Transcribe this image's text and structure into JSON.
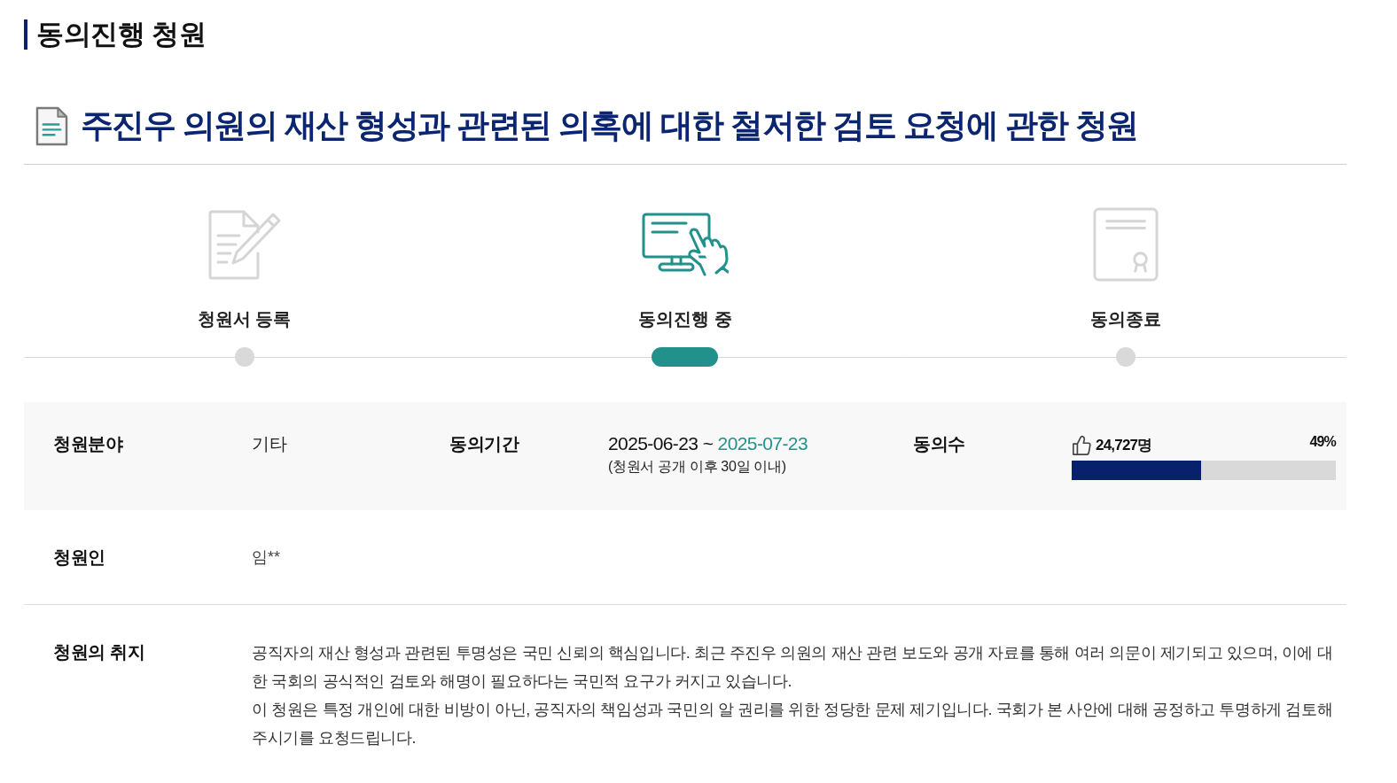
{
  "section_heading": "동의진행 청원",
  "petition": {
    "title": "주진우 의원의 재산 형성과 관련된 의혹에 대한 철저한 검토 요청에 관한 청원"
  },
  "steps": [
    {
      "kind": "register",
      "label": "청원서 등록",
      "selected": false
    },
    {
      "kind": "consent",
      "label": "동의진행 중",
      "selected": true
    },
    {
      "kind": "closed",
      "label": "동의종료",
      "selected": false
    }
  ],
  "details": {
    "category": {
      "label": "청원분야",
      "value": "기타"
    },
    "period": {
      "label": "동의기간",
      "start": "2025-06-23",
      "separator": "~",
      "end": "2025-07-23",
      "note": "(청원서 공개 이후 30일 이내)"
    },
    "agreements": {
      "label": "동의수",
      "count": "24,727명",
      "percent": "49%",
      "level": 0.49
    }
  },
  "petitioner": {
    "label": "청원인",
    "value": "임**"
  },
  "purpose": {
    "label": "청원의 취지",
    "paragraphs": [
      "공직자의 재산 형성과 관련된 투명성은 국민 신뢰의 핵심입니다. 최근 주진우 의원의 재산 관련 보도와 공개 자료를 통해 여러 의문이 제기되고 있으며, 이에 대한 국회의 공식적인 검토와 해명이 필요하다는 국민적 요구가 커지고 있습니다.",
      "이 청원은 특정 개인에 대한 비방이 아닌, 공직자의 책임성과 국민의 알 권리를 위한 정당한 문제 제기입니다. 국회가 본 사안에 대해 공정하고 투명하게 검토해 주시기를 요청드립니다."
    ]
  }
}
